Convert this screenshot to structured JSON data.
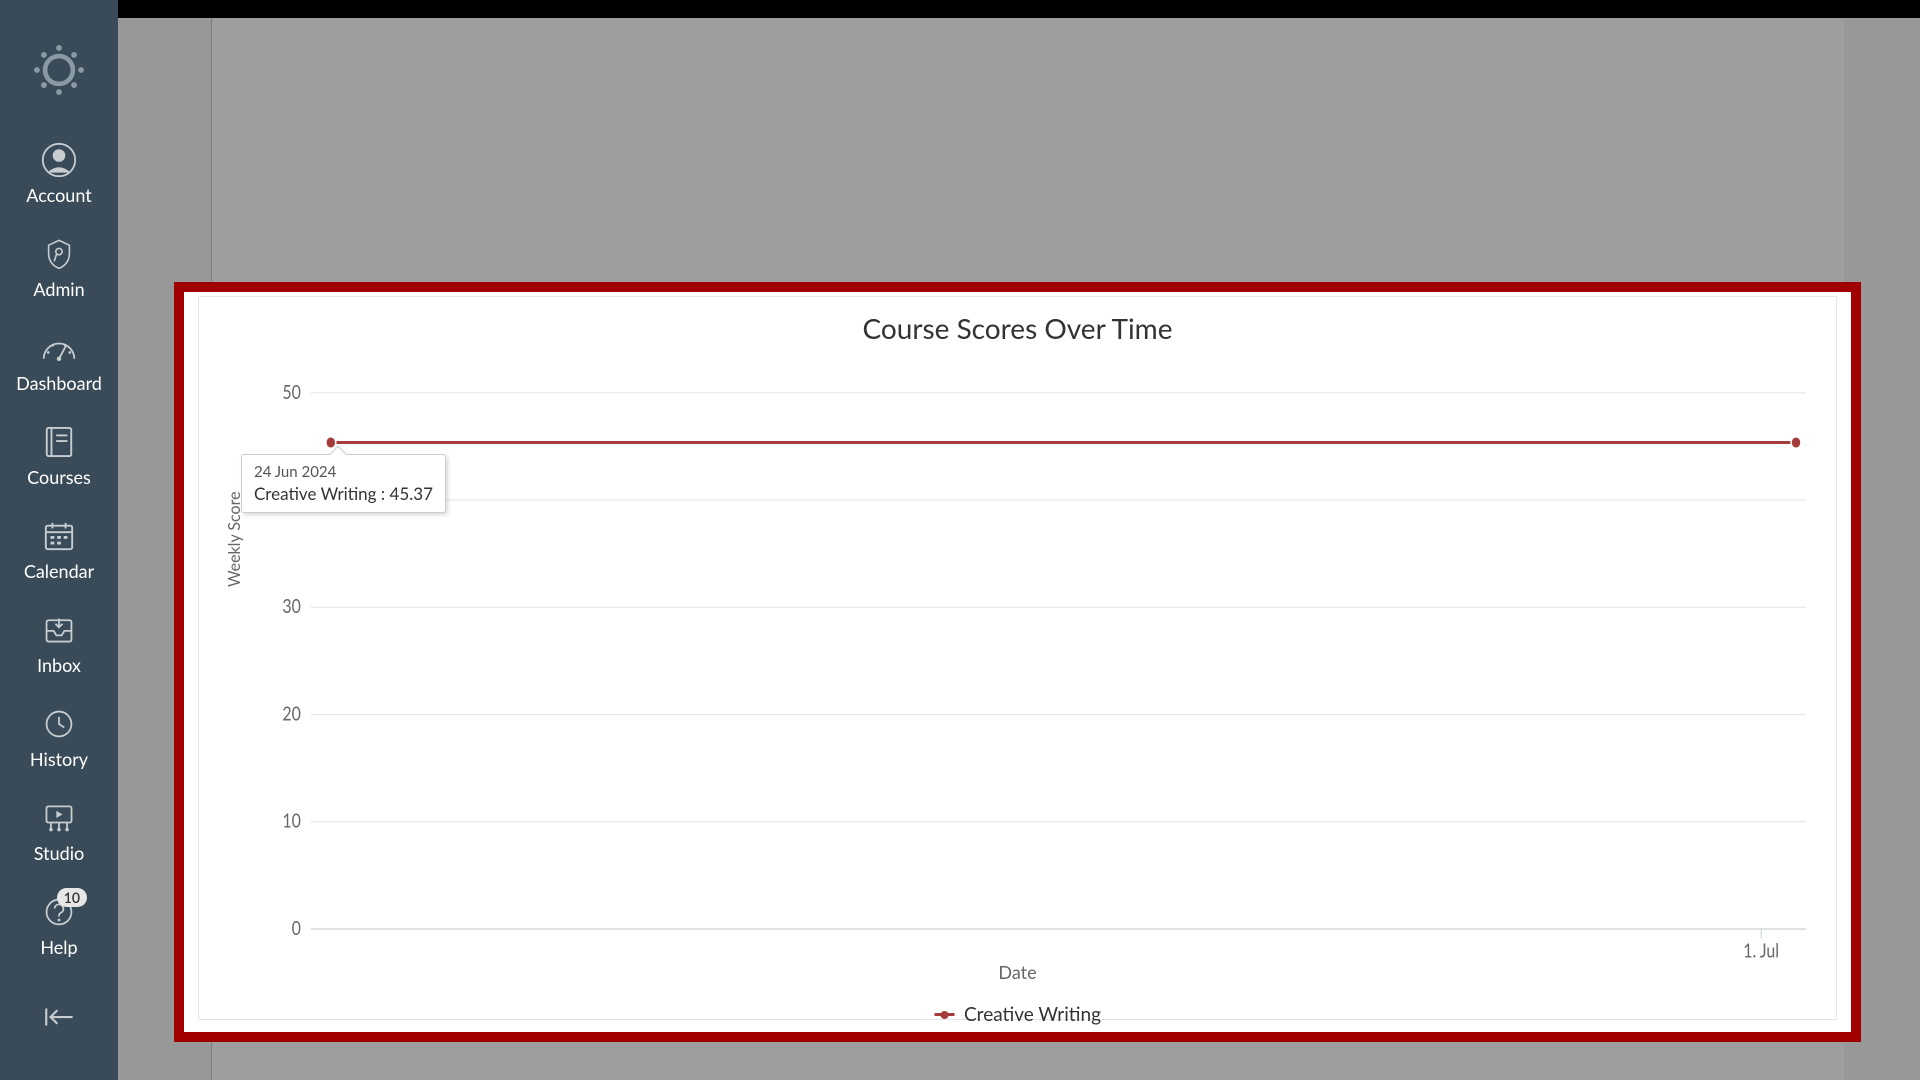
{
  "sidebar": {
    "items": [
      {
        "label": "Account",
        "icon": "account-icon"
      },
      {
        "label": "Admin",
        "icon": "admin-icon"
      },
      {
        "label": "Dashboard",
        "icon": "dashboard-icon"
      },
      {
        "label": "Courses",
        "icon": "courses-icon"
      },
      {
        "label": "Calendar",
        "icon": "calendar-icon"
      },
      {
        "label": "Inbox",
        "icon": "inbox-icon"
      },
      {
        "label": "History",
        "icon": "history-icon"
      },
      {
        "label": "Studio",
        "icon": "studio-icon"
      },
      {
        "label": "Help",
        "icon": "help-icon",
        "badge": "10"
      }
    ]
  },
  "chart_data": {
    "type": "line",
    "title": "Course Scores Over Time",
    "xlabel": "Date",
    "ylabel": "Weekly Score",
    "ylim": [
      0,
      50
    ],
    "y_ticks": [
      0,
      10,
      20,
      30,
      40,
      50
    ],
    "x_ticks": [
      "1. Jul"
    ],
    "series": [
      {
        "name": "Creative Writing",
        "color": "#a63b3b",
        "points": [
          {
            "x_label": "24 Jun 2024",
            "y": 45.37
          },
          {
            "x_label": "1 Jul 2024",
            "y": 45.37
          }
        ]
      }
    ]
  },
  "tooltip": {
    "date": "24 Jun 2024",
    "series_name": "Creative Writing",
    "value": "45.37"
  }
}
